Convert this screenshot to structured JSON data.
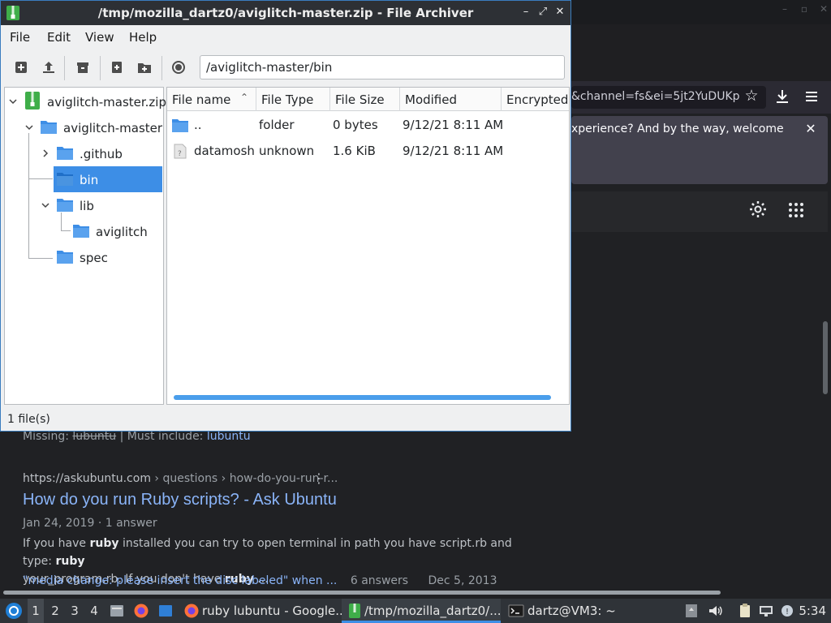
{
  "browser": {
    "url_fragment": "&channel=fs&ei=5jt2YuDUKp",
    "notice_text": "xperience? And by the way, welcome",
    "result": {
      "missing_label": "Missing:",
      "missing_term": "lubuntu",
      "must_include_label": "| Must include:",
      "must_include_term": "lubuntu",
      "cite_site": "https://askubuntu.com",
      "cite_path": " › questions › how-do-you-run-r...",
      "title": "How do you run Ruby scripts? - Ask Ubuntu",
      "meta": "Jan 24, 2019 · 1 answer",
      "snippet_1_pre": "If you have ",
      "snippet_1_b1": "ruby",
      "snippet_1_mid": " installed you can try to open terminal in path you have script.rb and type: ",
      "snippet_1_b2": "ruby",
      "snippet_2_pre": "your_program.rb. If you don't have ",
      "snippet_2_b": "ruby",
      "snippet_2_post": " ...",
      "related_link": "\"media change: please insert the disc labeled\" when ...",
      "related_answers": "6 answers",
      "related_date": "Dec 5, 2013"
    }
  },
  "archiver": {
    "title": "/tmp/mozilla_dartz0/aviglitch-master.zip - File Archiver",
    "menu": [
      "File",
      "Edit",
      "View",
      "Help"
    ],
    "path": "/aviglitch-master/bin",
    "tree": {
      "root": "aviglitch-master.zip",
      "folder": "aviglitch-master",
      "children": [
        ".github",
        "bin",
        "lib",
        "aviglitch",
        "spec"
      ],
      "selected": "bin"
    },
    "columns": [
      "File name",
      "File Type",
      "File Size",
      "Modified",
      "Encrypted"
    ],
    "rows": [
      {
        "name": "..",
        "type": "folder",
        "size": "0 bytes",
        "modified": "9/12/21 8:11 AM"
      },
      {
        "name": "datamosh",
        "type": "unknown",
        "size": "1.6 KiB",
        "modified": "9/12/21 8:11 AM"
      }
    ],
    "status": "1 file(s)"
  },
  "taskbar": {
    "workspaces": [
      "1",
      "2",
      "3",
      "4"
    ],
    "active_workspace": "1",
    "tasks": [
      {
        "label": "ruby lubuntu - Google...",
        "icon": "firefox-icon"
      },
      {
        "label": "/tmp/mozilla_dartz0/...",
        "icon": "archive-icon"
      },
      {
        "label": "dartz@VM3: ~",
        "icon": "terminal-icon"
      }
    ],
    "clock": "5:34"
  },
  "colors": {
    "selection": "#3d8ee6",
    "link": "#8ab4f8",
    "archiver_title_bg": "#2d3035"
  }
}
